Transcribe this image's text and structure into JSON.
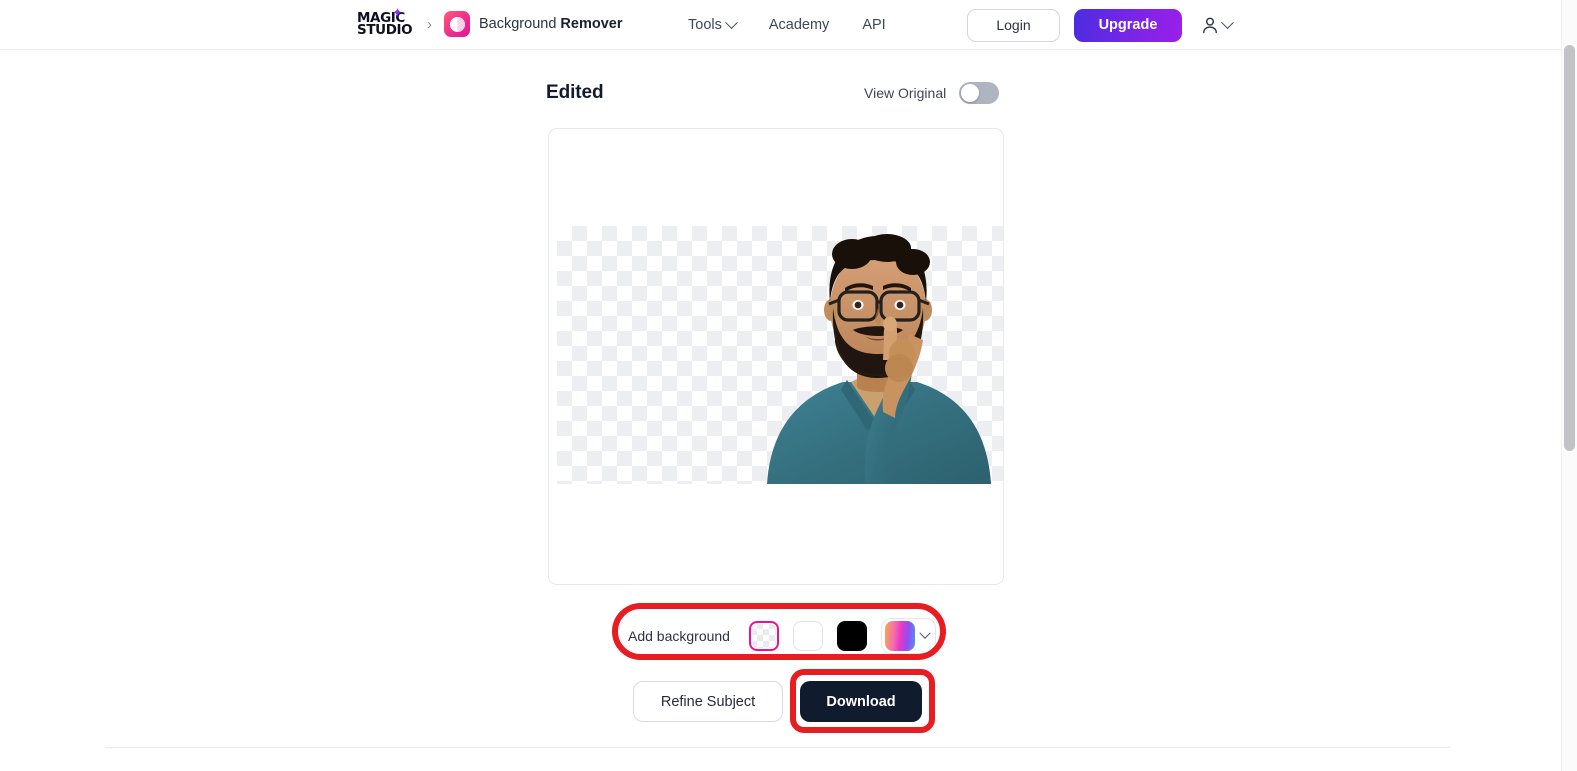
{
  "header": {
    "logo": {
      "line1": "MAGIC",
      "line2": "STUDIO",
      "star_icon": "sparkle-icon"
    },
    "breadcrumb_separator": "›",
    "app_icon": "background-remover-app-icon",
    "breadcrumb_title_regular": "Background ",
    "breadcrumb_title_bold": "Remover",
    "nav": [
      {
        "label": "Tools",
        "has_chevron": true
      },
      {
        "label": "Academy",
        "has_chevron": false
      },
      {
        "label": "API",
        "has_chevron": false
      }
    ],
    "login_label": "Login",
    "upgrade_label": "Upgrade",
    "account_icon": "user-account-icon",
    "account_chevron_icon": "chevron-down-icon",
    "upgrade_gradient_from": "#4b2de0",
    "upgrade_gradient_to": "#9b1fe8"
  },
  "editor": {
    "title": "Edited",
    "view_original_label": "View Original",
    "view_original_enabled": false,
    "canvas": {
      "background": "transparent-checkerboard",
      "subject_description": "Man with beard and glasses making a shush gesture wearing a teal shirt"
    }
  },
  "background_panel": {
    "label": "Add background",
    "swatches": [
      {
        "name": "transparent",
        "selected": true,
        "color": "transparent"
      },
      {
        "name": "white",
        "selected": false,
        "color": "#ffffff"
      },
      {
        "name": "black",
        "selected": false,
        "color": "#000000"
      },
      {
        "name": "gradient",
        "selected": false,
        "color": "#e936c6"
      }
    ],
    "selection_color": "#ec1193",
    "expand_icon": "chevron-down-icon"
  },
  "actions": {
    "refine_label": "Refine Subject",
    "download_label": "Download",
    "download_bg": "#111b2e"
  },
  "annotations": {
    "color": "#e81d22",
    "highlighted": [
      "add-background-row",
      "download-button"
    ]
  }
}
